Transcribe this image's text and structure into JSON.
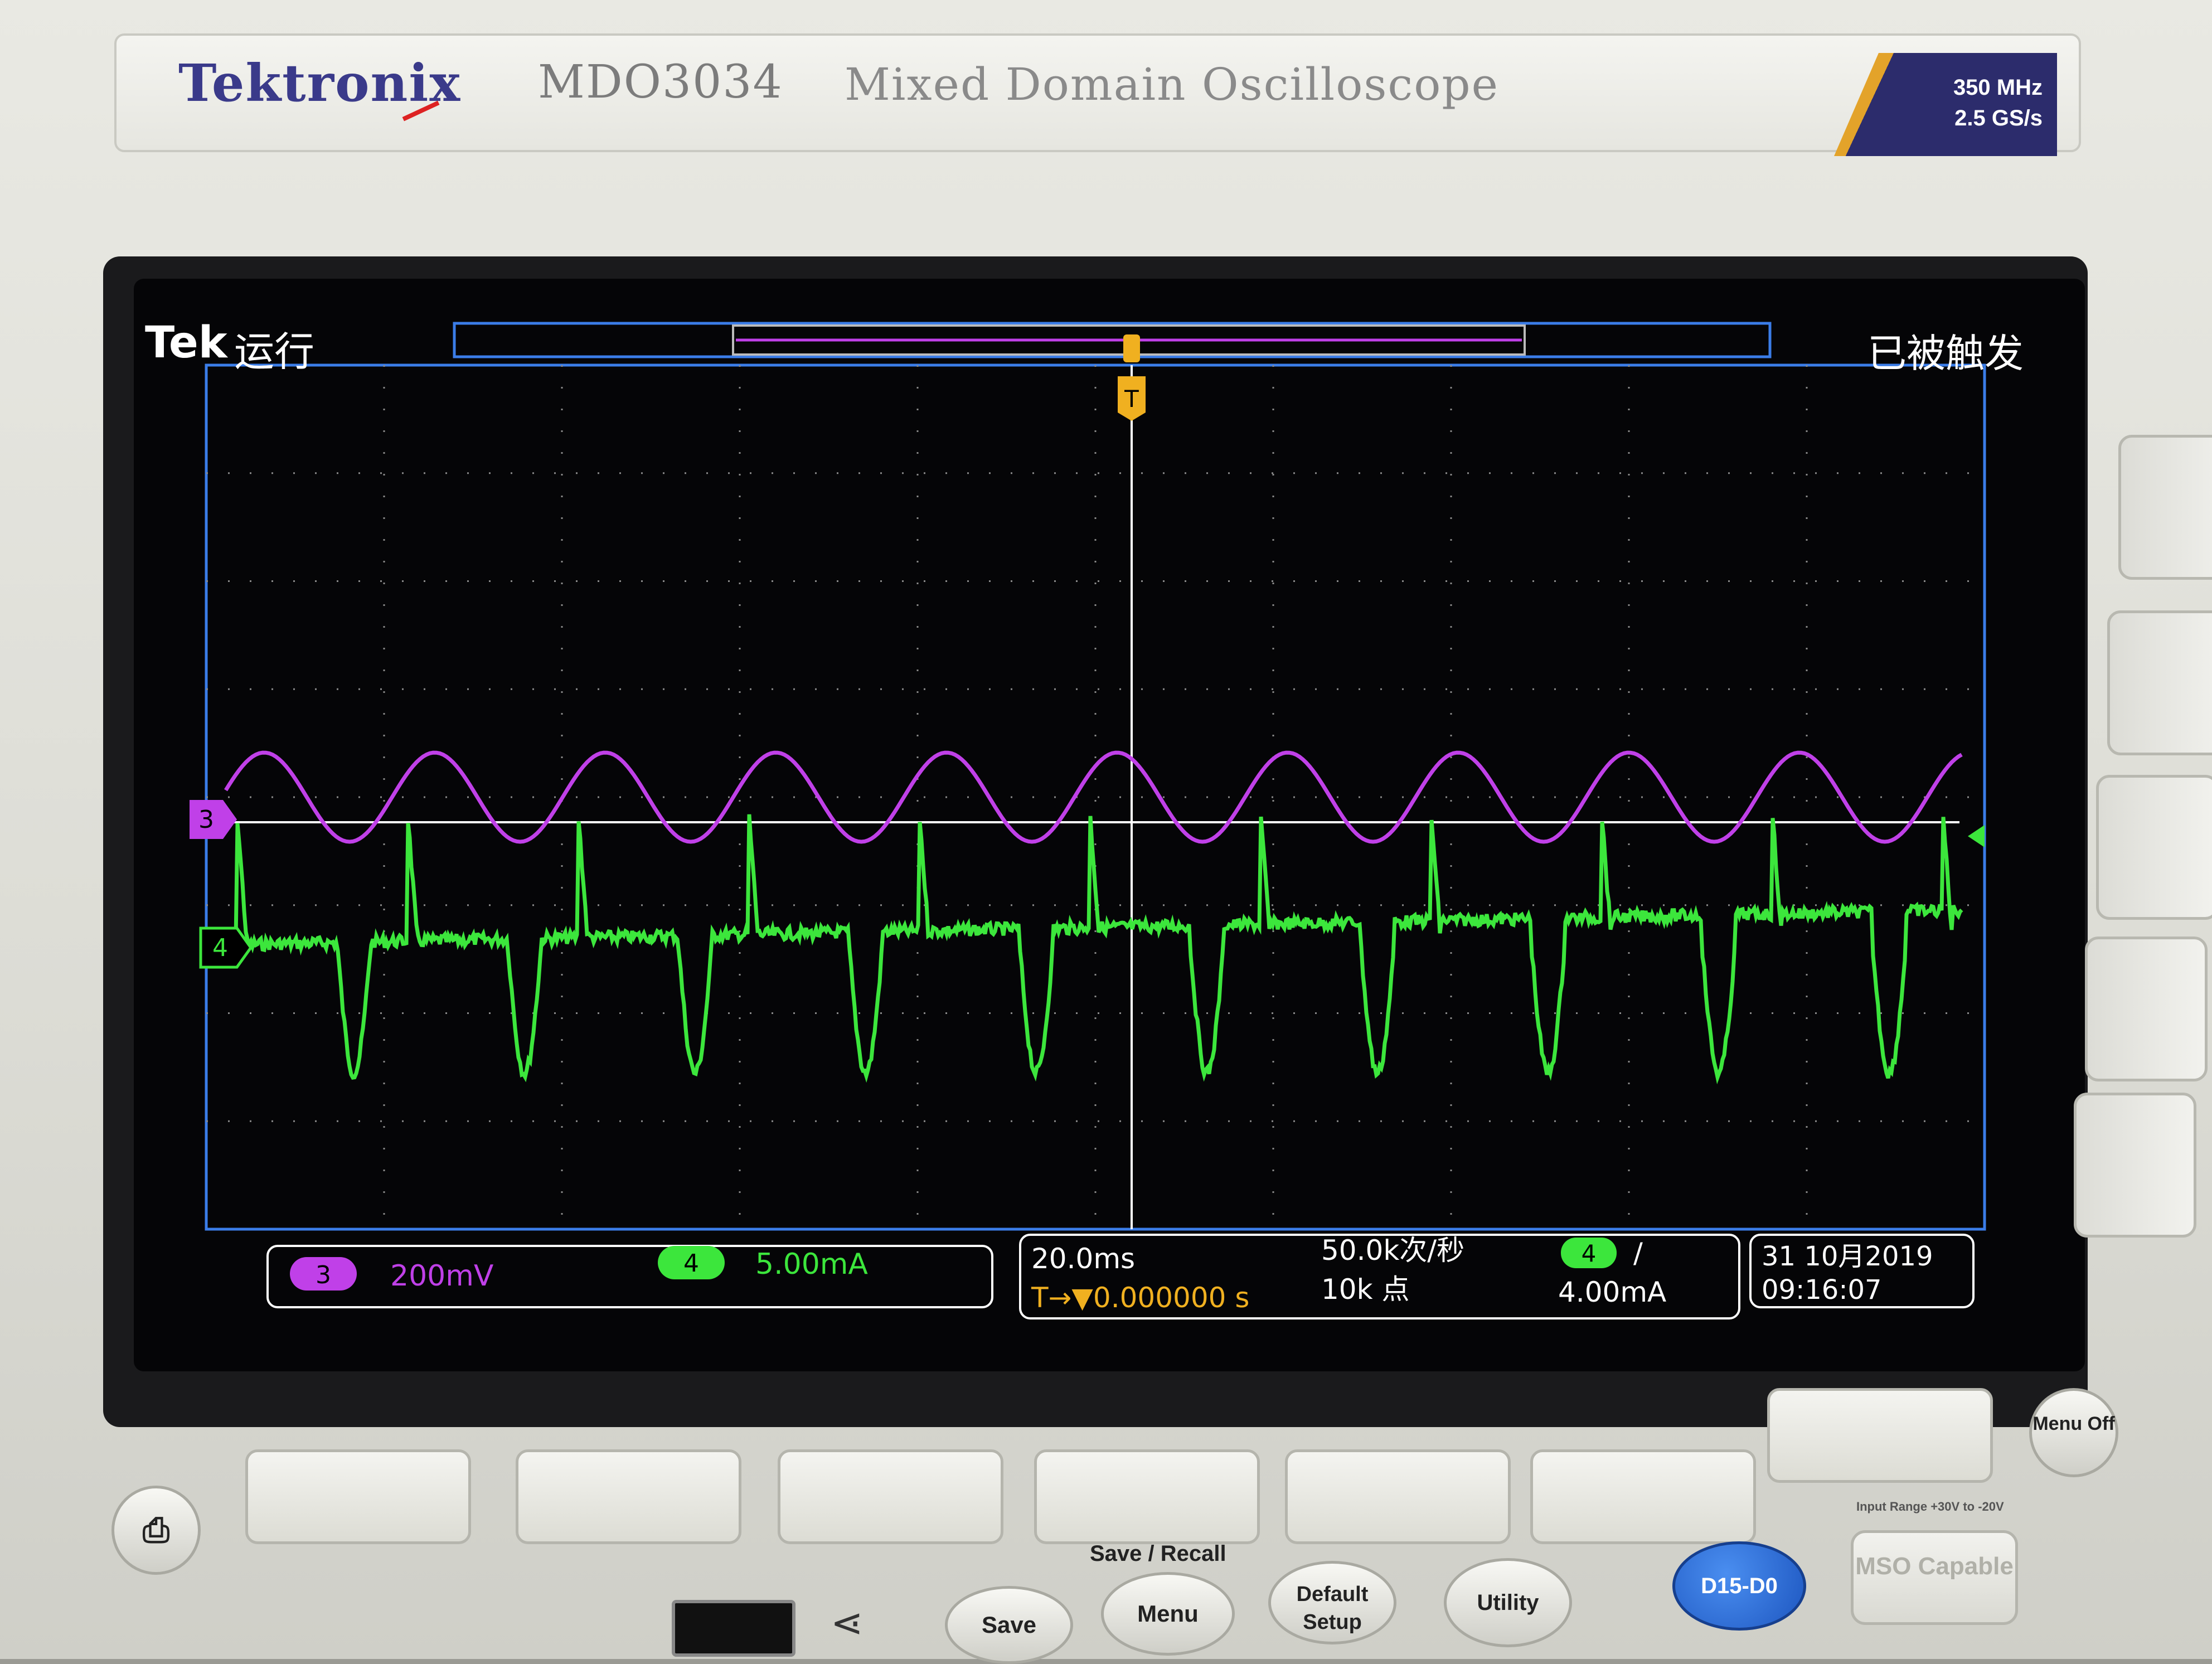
{
  "device": {
    "brand": "Tektronix",
    "model": "MDO3034",
    "description": "Mixed Domain Oscilloscope",
    "bandwidth": "350 MHz",
    "sample_rate": "2.5 GS/s"
  },
  "screen": {
    "logo": "Tek",
    "run_state": "运行",
    "trigger_state": "已被触发",
    "trigger_marker": "T",
    "ch3": {
      "marker": "3",
      "scale": "200mV",
      "color": "#c040e8"
    },
    "ch4": {
      "marker": "4",
      "scale": "5.00mA",
      "color": "#3ce63c"
    },
    "timebase": "20.0ms",
    "trigger_position": "T→▼0.000000 s",
    "sample_rate": "50.0k次/秒",
    "record_length": "10k 点",
    "trigger_source": "4",
    "trigger_slope": "/",
    "trigger_level": "4.00mA",
    "date": "31 10月2019",
    "time": "09:16:07"
  },
  "panel": {
    "save_recall_label": "Save / Recall",
    "save": "Save",
    "menu": "Menu",
    "default_setup": "Default Setup",
    "utility": "Utility",
    "digital_channels": "D15-D0",
    "menu_off": "Menu Off",
    "mso": "MSO Capable",
    "input_range": "Input Range +30V to -20V"
  },
  "colors": {
    "grid": "#9a9a9a",
    "frame": "#3b7de8",
    "trigger": "#f0b020",
    "reference": "#ffffff"
  }
}
